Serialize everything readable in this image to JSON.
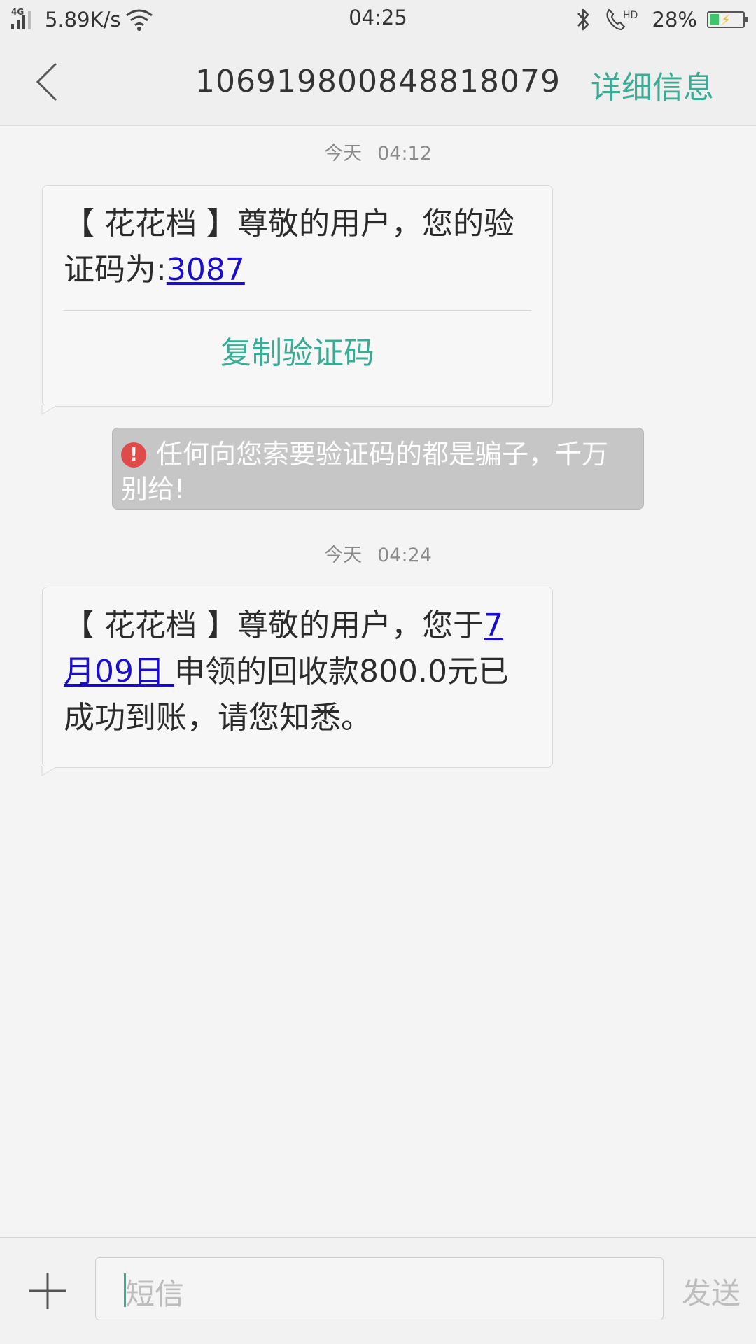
{
  "status_bar": {
    "network_type": "4G",
    "speed": "5.89K/s",
    "time": "04:25",
    "battery_percent": "28%",
    "battery_level": 0.28,
    "icons": [
      "signal-icon",
      "wifi-icon",
      "bluetooth-icon",
      "hd-call-icon",
      "battery-icon"
    ]
  },
  "header": {
    "title": "106919800848818079",
    "details_label": "详细信息",
    "back_icon": "chevron-left-icon"
  },
  "messages": [
    {
      "date": "今天",
      "time": "04:12",
      "text_before_link": "【 花花档 】尊敬的用户，您的验证码为:",
      "link_text": "3087",
      "action_label": "复制验证码"
    },
    {
      "date": "今天",
      "time": "04:24",
      "text_before_link": "【 花花档 】尊敬的用户，您于",
      "link_text": "7月09日 ",
      "text_after_link": "申领的回收款800.0元已成功到账，请您知悉。"
    }
  ],
  "warning": {
    "icon": "!",
    "text": "任何向您索要验证码的都是骗子，千万别给!"
  },
  "input_bar": {
    "placeholder": "短信",
    "send_label": "发送",
    "add_icon": "plus-icon"
  },
  "colors": {
    "accent": "#3aab94",
    "link": "#1a0dcc",
    "warning_icon": "#e04a4a",
    "background": "#f4f4f4"
  }
}
